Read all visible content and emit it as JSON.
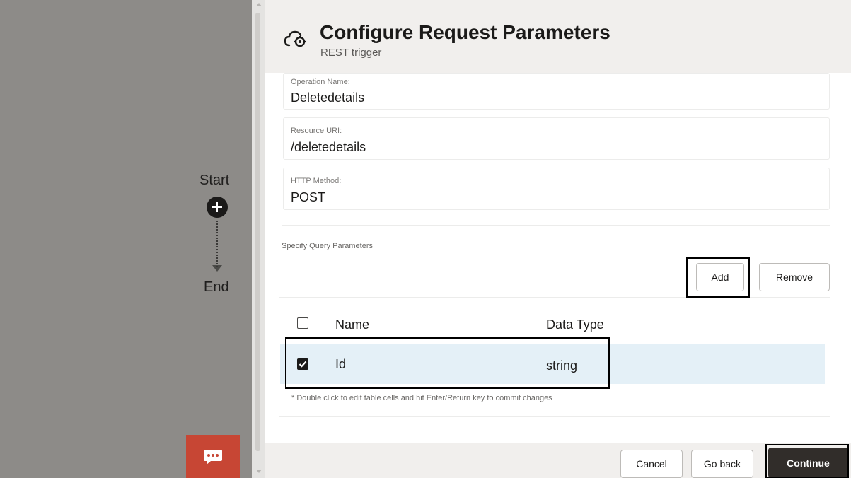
{
  "canvas": {
    "start_label": "Start",
    "end_label": "End"
  },
  "panel": {
    "title": "Configure Request Parameters",
    "subtitle": "REST trigger",
    "fields": {
      "operation": {
        "label": "Operation Name:",
        "value": "Deletedetails"
      },
      "resource": {
        "label": "Resource URI:",
        "value": "/deletedetails"
      },
      "method": {
        "label": "HTTP Method:",
        "value": "POST"
      }
    },
    "query_section_label": "Specify Query Parameters",
    "buttons": {
      "add": "Add",
      "remove": "Remove",
      "cancel": "Cancel",
      "go_back": "Go back",
      "continue": "Continue"
    },
    "table": {
      "columns": [
        "Name",
        "Data Type"
      ],
      "rows": [
        {
          "name": "Id",
          "data_type": "string",
          "checked": true
        }
      ],
      "hint": "* Double click to edit table cells and hit Enter/Return key to commit changes"
    }
  },
  "icons": {
    "header": "cloud-trigger-icon",
    "flow_add": "plus-icon",
    "chat": "chat-icon"
  },
  "colors": {
    "canvas_bg": "#8d8b88",
    "header_bg": "#f1efed",
    "selected_row_bg": "#e4f0f7",
    "chat_button_bg": "#c74634",
    "primary_button_bg": "#312d2a"
  }
}
